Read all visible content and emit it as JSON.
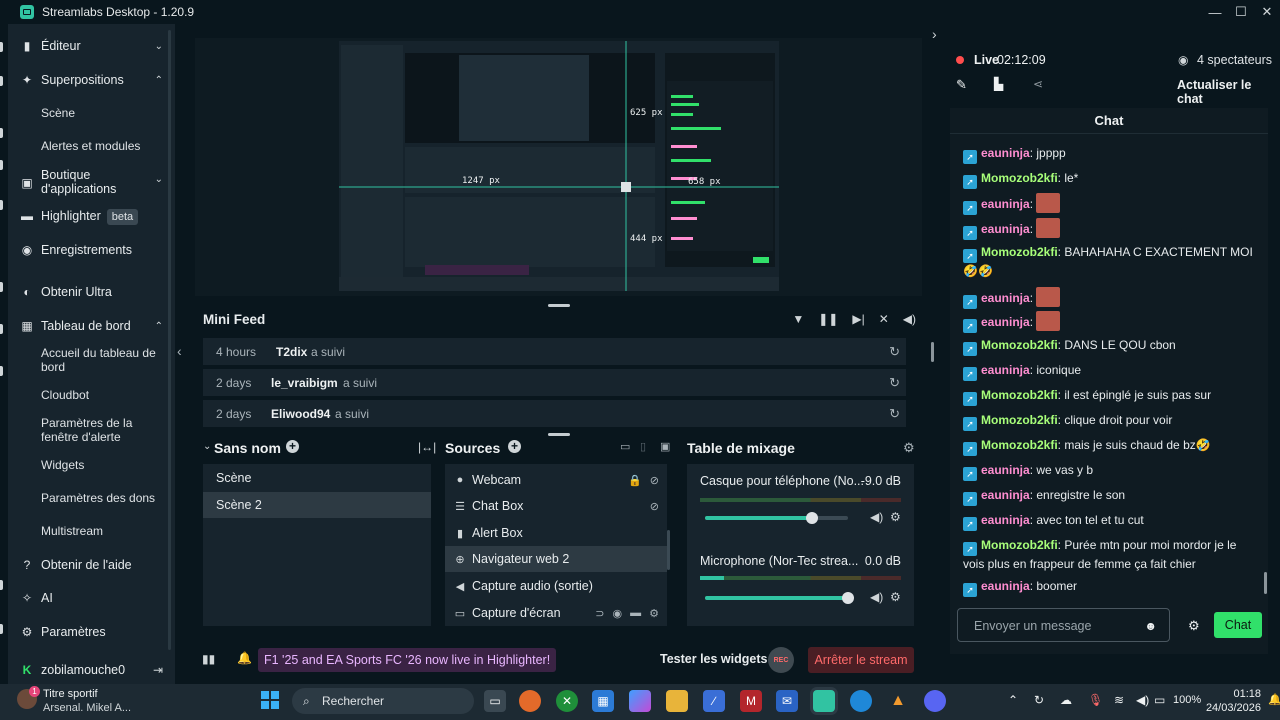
{
  "window": {
    "title": "Streamlabs Desktop - 1.20.9"
  },
  "sidebar": {
    "editor": "Éditeur",
    "overlays": "Superpositions",
    "scene": "Scène",
    "alerts": "Alertes et modules",
    "appstore": "Boutique d'applications",
    "highlighter": "Highlighter",
    "beta": "beta",
    "recordings": "Enregistrements",
    "ultra": "Obtenir Ultra",
    "dashboard": "Tableau de bord",
    "dashboard_home": "Accueil du tableau de bord",
    "cloudbot": "Cloudbot",
    "alertbox_settings": "Paramètres de la fenêtre d'alerte",
    "widgets": "Widgets",
    "donation_settings": "Paramètres des dons",
    "multistream": "Multistream",
    "help": "Obtenir de l'aide",
    "ai": "AI",
    "settings": "Paramètres",
    "user": "zobilamouche0"
  },
  "preview": {
    "measure_top": "625 px",
    "measure_left": "1247 px",
    "measure_right": "658 px",
    "measure_bottom": "444 px"
  },
  "minifeed": {
    "title": "Mini Feed",
    "rows": [
      {
        "time": "4 hours",
        "user": "T2dix",
        "action": "a suivi"
      },
      {
        "time": "2 days",
        "user": "le_vraibigm",
        "action": "a suivi"
      },
      {
        "time": "2 days",
        "user": "Eliwood94",
        "action": "a suivi"
      }
    ]
  },
  "scenes": {
    "title": "Sans nom",
    "items": [
      "Scène",
      "Scène 2"
    ]
  },
  "sources": {
    "title": "Sources",
    "items": [
      "Webcam",
      "Chat Box",
      "Alert Box",
      "Navigateur web 2",
      "Capture audio (sortie)",
      "Capture d'écran"
    ]
  },
  "mixer": {
    "title": "Table de mixage",
    "channels": [
      {
        "name": "Casque pour téléphone (No...",
        "db": "-9.0 dB",
        "level": 0.75
      },
      {
        "name": "Microphone (Nor-Tec strea...",
        "db": "0.0 dB",
        "level": 1.0
      }
    ]
  },
  "footer": {
    "promo": "F1 '25 and EA Sports FC '26 now live in Highlighter!",
    "test_widgets": "Tester les widgets",
    "rec": "REC",
    "stop": "Arrêter le stream"
  },
  "live": {
    "label": "Live",
    "time": "02:12:09",
    "viewers": "4 spectateurs",
    "refresh": "Actualiser le chat"
  },
  "chat": {
    "title": "Chat",
    "messages": [
      {
        "user": "eauninja",
        "text": ": jpppp",
        "color": "n1"
      },
      {
        "user": "Momozob2kfi",
        "text": ": le*",
        "color": "n2"
      },
      {
        "user": "eauninja",
        "text": ":",
        "color": "n1",
        "emote": true
      },
      {
        "user": "eauninja",
        "text": ":",
        "color": "n1",
        "emote": true
      },
      {
        "user": "Momozob2kfi",
        "text": ": BAHAHAHA C EXACTEMENT MOI🤣🤣",
        "color": "n2"
      },
      {
        "user": "eauninja",
        "text": ":",
        "color": "n1",
        "emote": true
      },
      {
        "user": "eauninja",
        "text": ":",
        "color": "n1",
        "emote": true
      },
      {
        "user": "Momozob2kfi",
        "text": ": DANS LE QOU cbon",
        "color": "n2"
      },
      {
        "user": "eauninja",
        "text": ": iconique",
        "color": "n1"
      },
      {
        "user": "Momozob2kfi",
        "text": ": il est épinglé je suis pas sur",
        "color": "n2"
      },
      {
        "user": "Momozob2kfi",
        "text": ": clique droit pour voir",
        "color": "n2"
      },
      {
        "user": "Momozob2kfi",
        "text": ": mais je suis chaud de bz🤣",
        "color": "n2"
      },
      {
        "user": "eauninja",
        "text": ": we vas y b",
        "color": "n1"
      },
      {
        "user": "eauninja",
        "text": ": enregistre le son",
        "color": "n1"
      },
      {
        "user": "eauninja",
        "text": ": avec ton tel et tu cut",
        "color": "n1"
      },
      {
        "user": "Momozob2kfi",
        "text": ": Purée mtn pour moi mordor je le vois plus en frappeur de femme ça fait chier",
        "color": "n2"
      },
      {
        "user": "eauninja",
        "text": ": boomer",
        "color": "n1"
      }
    ],
    "placeholder": "Envoyer un message",
    "send": "Chat"
  },
  "taskbar": {
    "weather_title": "Titre sportif",
    "weather_sub": "Arsenal. Mikel A...",
    "search": "Rechercher",
    "battery": "100%",
    "time": "01:18",
    "date": "24/03/2026"
  }
}
